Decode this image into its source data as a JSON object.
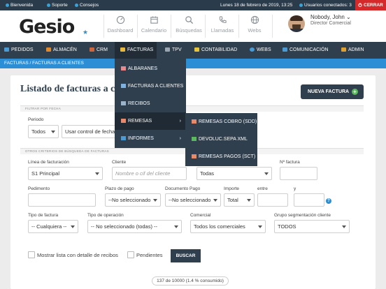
{
  "topbar": {
    "welcome": "Bienvenida",
    "support": "Soporte",
    "tips": "Consejos",
    "date": "Lunes 18 de febrero de 2019, 13:25",
    "users": "Usuarios conectados: 3",
    "exit": "CERRAR"
  },
  "header": {
    "logo": "Gesio",
    "nav": [
      "Dashboard",
      "Calendario",
      "Búsquedas",
      "Llamadas",
      "Webs"
    ],
    "user_name": "Nobody, John",
    "user_role": "Director Comercial"
  },
  "mainnav": [
    "PEDIDOS",
    "ALMACÉN",
    "CRM",
    "FACTURAS",
    "TPV",
    "CONTABILIDAD",
    "WEBS",
    "COMUNICACIÓN",
    "ADMIN"
  ],
  "breadcrumb": "FACTURAS / FACTURAS A CLIENTES",
  "page": {
    "title": "Listado de facturas a c",
    "new_button": "NUEVA FACTURA"
  },
  "filters": {
    "section_date": "FILTRAR POR FECHA",
    "periodo_label": "Periodo",
    "periodo_value": "Todos",
    "control_value": "Usar control de fecha",
    "section_other": "OTROS CRITERIOS DE BÚSQUEDA DE FACTURAS",
    "linea_label": "Línea de facturación",
    "linea_value": "S1 Principal",
    "cliente_label": "Cliente",
    "cliente_placeholder": "Nombre o cif del cliente",
    "estado_value": "Todas",
    "nfactura_label": "Nº factura",
    "pedimento_label": "Pedimento",
    "plazo_label": "Plazo de pago",
    "plazo_value": "--No seleccionado",
    "docpago_label": "Documento Pago",
    "docpago_value": "--No seleccionado",
    "importe_label": "Importe",
    "importe_value": "Total",
    "entre_label": "entre",
    "y_label": "y",
    "tipofactura_label": "Tipo de factura",
    "tipofactura_value": "-- Cualquiera --",
    "tipoop_label": "Tipo de operación",
    "tipoop_value": "-- No seleccionado (todas) --",
    "comercial_label": "Comercial",
    "comercial_value": "Todos los comerciales",
    "grupo_label": "Grupo segmentación cliente",
    "grupo_value": "TODOS",
    "detalle_label": "Mostrar lista con detalle de recibos",
    "pendientes_label": "Pendientes",
    "search_button": "BUSCAR",
    "count": "137 de 10000 (1.4 % consumido)"
  },
  "menu_facturas": [
    "ALBARANES",
    "FACTURAS A CLIENTES",
    "RECIBOS",
    "REMESAS",
    "INFORMES"
  ],
  "menu_remesas": [
    "REMESAS COBRO (SDD)",
    "DEVOLUC.SEPA XML",
    "REMESAS PAGOS (SCT)"
  ],
  "colors": {
    "nav": "#2f3f4e",
    "accent": "#2c8fd6",
    "exit": "#d62a2a",
    "success": "#5cb85c"
  }
}
